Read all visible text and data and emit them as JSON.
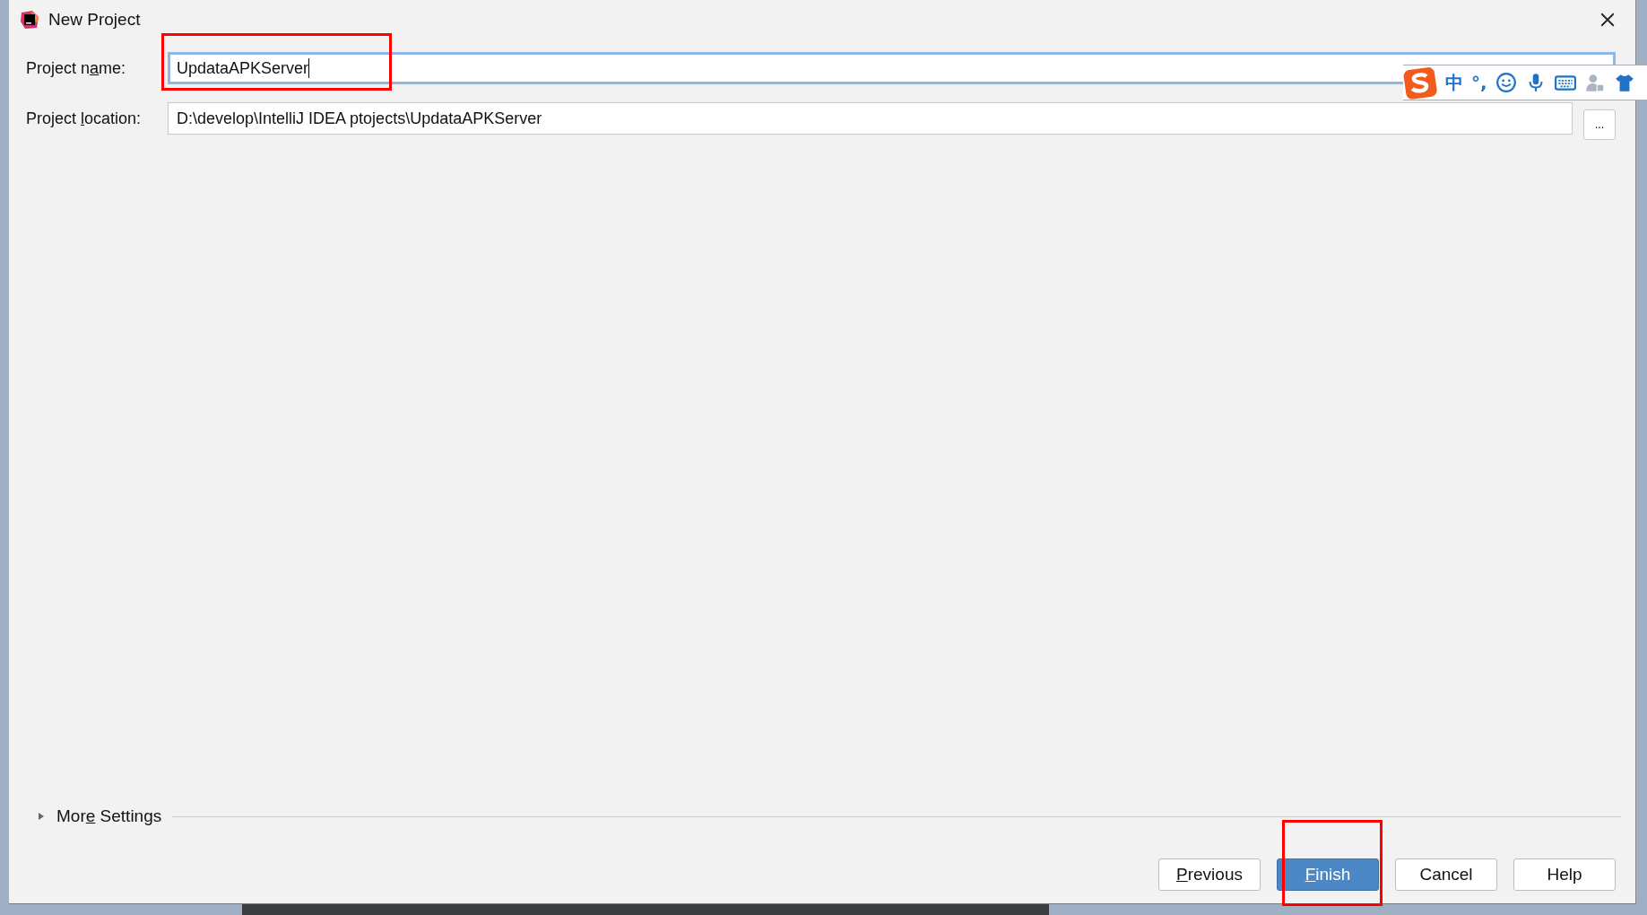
{
  "window": {
    "title": "New Project"
  },
  "fields": [
    {
      "kind": "name",
      "label": {
        "pre": "Project n",
        "key": "a",
        "post": "me:"
      },
      "value": "UpdataAPKServer",
      "focused": true,
      "highlighted": true
    },
    {
      "kind": "location",
      "label": {
        "pre": "Project ",
        "key": "l",
        "post": "ocation:"
      },
      "value": "D:\\develop\\IntelliJ IDEA ptojects\\UpdataAPKServer",
      "browse": "..."
    }
  ],
  "ime_toolbar": {
    "items": [
      {
        "kind": "logo"
      },
      {
        "kind": "text",
        "text": "中"
      },
      {
        "kind": "text",
        "text": "°,"
      },
      {
        "kind": "smile"
      },
      {
        "kind": "mic"
      },
      {
        "kind": "keyboard"
      },
      {
        "kind": "user"
      },
      {
        "kind": "shirt"
      }
    ]
  },
  "more_settings": {
    "label": {
      "pre": "Mor",
      "key": "e",
      "post": " Settings"
    },
    "expanded": false
  },
  "buttons": [
    {
      "label": {
        "key": "P",
        "post": "revious"
      },
      "default": false,
      "highlighted": false
    },
    {
      "label": {
        "key": "F",
        "post": "inish"
      },
      "default": true,
      "highlighted": true
    },
    {
      "label": {
        "pre": "Cancel"
      },
      "default": false,
      "highlighted": false
    },
    {
      "label": {
        "pre": "Help"
      },
      "default": false,
      "highlighted": false
    }
  ]
}
